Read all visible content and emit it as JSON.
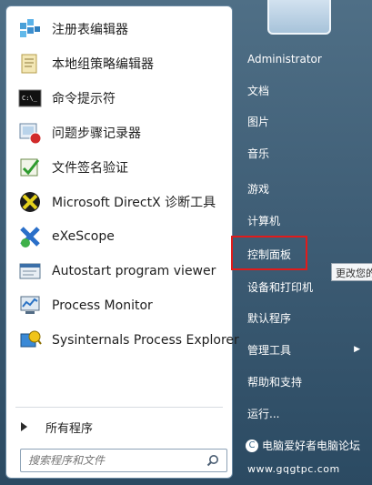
{
  "start_menu": {
    "programs": [
      {
        "name": "registry-editor",
        "label": "注册表编辑器",
        "icon": "registry-editor-icon"
      },
      {
        "name": "group-policy",
        "label": "本地组策略编辑器",
        "icon": "group-policy-icon"
      },
      {
        "name": "cmd",
        "label": "命令提示符",
        "icon": "command-prompt-icon"
      },
      {
        "name": "psr",
        "label": "问题步骤记录器",
        "icon": "steps-recorder-icon"
      },
      {
        "name": "sigverif",
        "label": "文件签名验证",
        "icon": "file-signature-icon"
      },
      {
        "name": "dxdiag",
        "label": "Microsoft DirectX 诊断工具",
        "icon": "directx-icon"
      },
      {
        "name": "exescope",
        "label": "eXeScope",
        "icon": "exescope-icon"
      },
      {
        "name": "autostart",
        "label": "Autostart program viewer",
        "icon": "autostart-viewer-icon"
      },
      {
        "name": "procmon",
        "label": "Process Monitor",
        "icon": "process-monitor-icon"
      },
      {
        "name": "procexp",
        "label": "Sysinternals Process Explorer",
        "icon": "process-explorer-icon"
      }
    ],
    "all_programs_label": "所有程序",
    "search_placeholder": "搜索程序和文件",
    "right_items": {
      "user": "Administrator",
      "documents": "文档",
      "pictures": "图片",
      "music": "音乐",
      "games": "游戏",
      "computer": "计算机",
      "control_panel": "控制面板",
      "devices": "设备和打印机",
      "default_programs": "默认程序",
      "admin_tools": "管理工具",
      "help": "帮助和支持",
      "run": "运行..."
    },
    "tooltip": "更改您的",
    "watermark": {
      "site_name": "电脑爱好者电脑论坛",
      "url": "www.gqgtpc.com"
    }
  }
}
